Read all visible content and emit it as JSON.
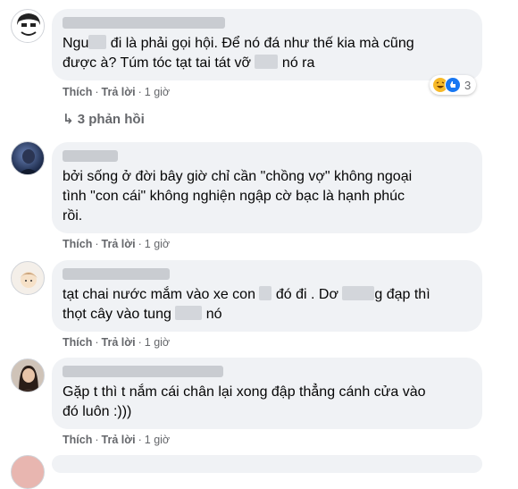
{
  "comments": [
    {
      "text_parts": [
        "Ngu",
        " đi là phải gọi hội. Để nó đá như thế kia mà cũng\nđược à? Túm tóc tạt tai tát vỡ ",
        " nó ra"
      ],
      "reactions": {
        "count": "3",
        "icons": [
          "laugh-emoji",
          "like-emoji"
        ]
      },
      "actions": {
        "like": "Thích",
        "reply": "Trả lời",
        "time": "1 giờ"
      },
      "replies_label": "3 phản hồi"
    },
    {
      "text": "bởi sống ở đời bây giờ chỉ cần \"chồng vợ\" không ngoại\ntình \"con cái\" không nghiện ngập cờ bạc là hạnh phúc\nrồi.",
      "actions": {
        "like": "Thích",
        "reply": "Trả lời",
        "time": "1 giờ"
      }
    },
    {
      "text_parts": [
        "tạt chai nước mắm vào xe con ",
        " đó đi . Dơ ",
        "g đạp thì\nthọt cây vào tung ",
        " nó"
      ],
      "actions": {
        "like": "Thích",
        "reply": "Trả lời",
        "time": "1 giờ"
      }
    },
    {
      "text": "Gặp t thì t nắm cái chân lại xong đập thẳng cánh cửa vào\nđó luôn :)))",
      "actions": {
        "like": "Thích",
        "reply": "Trả lời",
        "time": "1 giờ"
      }
    }
  ],
  "separator": "·",
  "colors": {
    "bubble": "#f0f2f5",
    "muted": "#65676b",
    "text": "#050505",
    "like_blue": "#1877f2",
    "haha_yellow": "#f7b928"
  }
}
